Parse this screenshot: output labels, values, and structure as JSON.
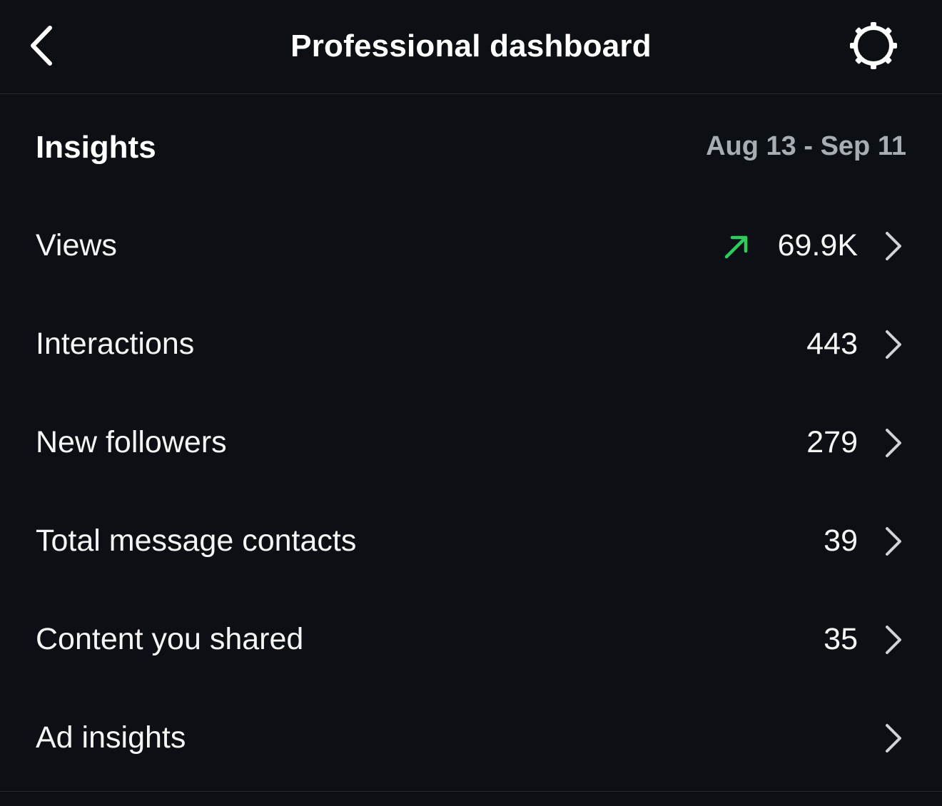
{
  "header": {
    "title": "Professional dashboard",
    "back_icon": "chevron-left-icon",
    "settings_icon": "gear-icon"
  },
  "insights": {
    "title": "Insights",
    "date_range": "Aug 13 - Sep 11",
    "rows": [
      {
        "label": "Views",
        "value": "69.9K",
        "trend": "up",
        "trend_color": "#2ecc5f"
      },
      {
        "label": "Interactions",
        "value": "443"
      },
      {
        "label": "New followers",
        "value": "279"
      },
      {
        "label": "Total message contacts",
        "value": "39"
      },
      {
        "label": "Content you shared",
        "value": "35"
      },
      {
        "label": "Ad insights",
        "value": ""
      }
    ]
  },
  "colors": {
    "background": "#0c1014",
    "text": "#f5f5f5",
    "muted": "#a8adb4",
    "divider": "#262a2f",
    "trend_up": "#2ecc5f"
  }
}
